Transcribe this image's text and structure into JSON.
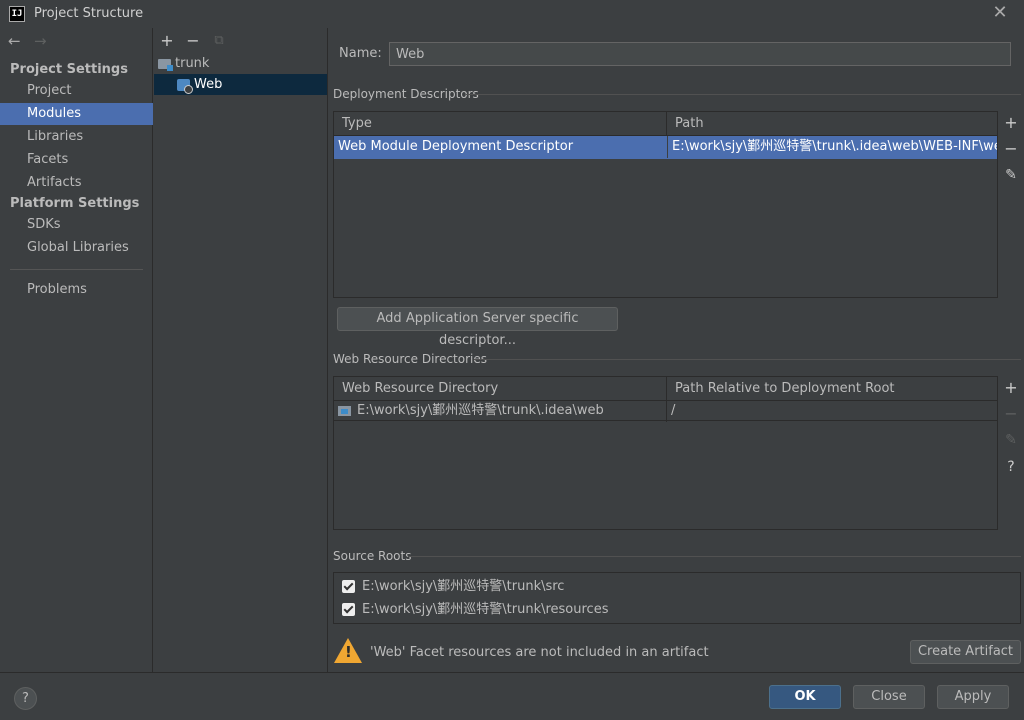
{
  "window": {
    "title": "Project Structure",
    "logo_text": "IJ",
    "close_glyph": "✕"
  },
  "nav": {
    "back_glyph": "←",
    "forward_glyph": "→"
  },
  "sidebar": {
    "project_settings_heading": "Project Settings",
    "platform_settings_heading": "Platform Settings",
    "items": [
      {
        "label": "Project"
      },
      {
        "label": "Modules",
        "selected": true
      },
      {
        "label": "Libraries"
      },
      {
        "label": "Facets"
      },
      {
        "label": "Artifacts"
      },
      {
        "label": "SDKs"
      },
      {
        "label": "Global Libraries"
      },
      {
        "label": "Problems"
      }
    ]
  },
  "tree": {
    "toolbar": {
      "add": "+",
      "remove": "−",
      "copy": "⧉"
    },
    "nodes": [
      {
        "label": "trunk",
        "icon": "module-folder-icon"
      },
      {
        "label": "Web",
        "icon": "web-facet-icon",
        "selected": true
      }
    ]
  },
  "main": {
    "name_label": "Name:",
    "name_value": "Web",
    "deployment": {
      "title": "Deployment Descriptors",
      "headers": [
        "Type",
        "Path"
      ],
      "rows": [
        {
          "type": "Web Module Deployment Descriptor",
          "path": "E:\\work\\sjy\\鄞州巡特警\\trunk\\.idea\\web\\WEB-INF\\web.xml"
        }
      ],
      "add_button": "Add Application Server specific descriptor..."
    },
    "web_resources": {
      "title": "Web Resource Directories",
      "headers": [
        "Web Resource Directory",
        "Path Relative to Deployment Root"
      ],
      "rows": [
        {
          "directory": "E:\\work\\sjy\\鄞州巡特警\\trunk\\.idea\\web",
          "relative": "/"
        }
      ]
    },
    "side_tools": {
      "add": "+",
      "remove": "−",
      "edit": "✎",
      "help": "?"
    },
    "source_roots": {
      "title": "Source Roots",
      "items": [
        {
          "path": "E:\\work\\sjy\\鄞州巡特警\\trunk\\src",
          "checked": true
        },
        {
          "path": "E:\\work\\sjy\\鄞州巡特警\\trunk\\resources",
          "checked": true
        }
      ]
    },
    "warning": {
      "text": "'Web' Facet resources are not included in an artifact",
      "mark": "!",
      "button": "Create Artifact"
    }
  },
  "footer": {
    "help": "?",
    "ok": "OK",
    "close": "Close",
    "apply": "Apply"
  },
  "colors": {
    "background": "#3c3f41",
    "selection": "#4b6eaf",
    "tree_selection": "#0d293e",
    "primary_button": "#365880",
    "warning": "#f0a732"
  }
}
